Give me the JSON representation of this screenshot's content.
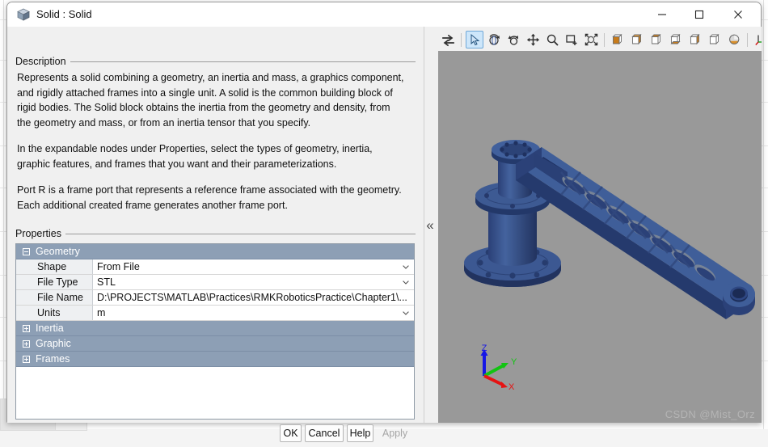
{
  "window": {
    "title": "Solid : Solid",
    "icon": "solid-cube-icon",
    "controls": {
      "minimize": "minimize-icon",
      "maximize": "maximize-icon",
      "close": "close-icon"
    }
  },
  "description": {
    "group_label": "Description",
    "paragraphs": [
      "Represents a solid combining a geometry, an inertia and mass, a graphics component, and rigidly attached frames into a single unit. A solid is the common building block of rigid bodies. The Solid block obtains the inertia from the geometry and density, from the geometry and mass, or from an inertia tensor that you specify.",
      "In the expandable nodes under Properties, select the types of geometry, inertia, graphic features, and frames that you want and their parameterizations.",
      "Port R is a frame port that represents a reference frame associated with the geometry. Each additional created frame generates another frame port."
    ]
  },
  "properties": {
    "group_label": "Properties",
    "nodes": [
      {
        "name": "Geometry",
        "expanded": true,
        "expander": "minus-box-icon",
        "rows": [
          {
            "label": "Shape",
            "value": "From File",
            "control": "dropdown"
          },
          {
            "label": "File Type",
            "value": "STL",
            "control": "dropdown"
          },
          {
            "label": "File Name",
            "value": "D:\\PROJECTS\\MATLAB\\Practices\\RMKRoboticsPractice\\Chapter1\\...",
            "control": "text"
          },
          {
            "label": "Units",
            "value": "m",
            "control": "dropdown"
          }
        ]
      },
      {
        "name": "Inertia",
        "expanded": false,
        "expander": "plus-box-icon",
        "rows": []
      },
      {
        "name": "Graphic",
        "expanded": false,
        "expander": "plus-box-icon",
        "rows": []
      },
      {
        "name": "Frames",
        "expanded": false,
        "expander": "plus-box-icon",
        "rows": []
      }
    ]
  },
  "buttons": {
    "ok": "OK",
    "cancel": "Cancel",
    "help": "Help",
    "apply": "Apply",
    "apply_enabled": false
  },
  "splitter": {
    "collapse_label": "«"
  },
  "viewer": {
    "toolbar": [
      {
        "name": "toggle-view-icon",
        "group": 0,
        "active": false
      },
      {
        "name": "select-cursor-icon",
        "group": 1,
        "active": true
      },
      {
        "name": "rotate-view-icon",
        "group": 1,
        "active": false
      },
      {
        "name": "orbit-icon",
        "group": 1,
        "active": false
      },
      {
        "name": "pan-icon",
        "group": 1,
        "active": false
      },
      {
        "name": "zoom-icon",
        "group": 1,
        "active": false
      },
      {
        "name": "zoom-box-icon",
        "group": 1,
        "active": false
      },
      {
        "name": "fit-to-view-icon",
        "group": 1,
        "active": false
      },
      {
        "name": "view-front-icon",
        "group": 2,
        "active": false
      },
      {
        "name": "view-back-icon",
        "group": 2,
        "active": false
      },
      {
        "name": "view-top-icon",
        "group": 2,
        "active": false
      },
      {
        "name": "view-bottom-icon",
        "group": 2,
        "active": false
      },
      {
        "name": "view-left-icon",
        "group": 2,
        "active": false
      },
      {
        "name": "view-right-icon",
        "group": 2,
        "active": false
      },
      {
        "name": "view-isometric-icon",
        "group": 2,
        "active": false
      },
      {
        "name": "coordinate-axes-icon",
        "group": 3,
        "active": false
      }
    ],
    "background_color": "#999999",
    "model_color": "#3a5ba0",
    "model_description": "robot-arm-link",
    "axes": {
      "x_label": "X",
      "y_label": "Y",
      "z_label": "Z",
      "x_color": "#e01010",
      "y_color": "#10c010",
      "z_color": "#1010e0"
    },
    "watermark": "CSDN @Mist_Orz"
  }
}
